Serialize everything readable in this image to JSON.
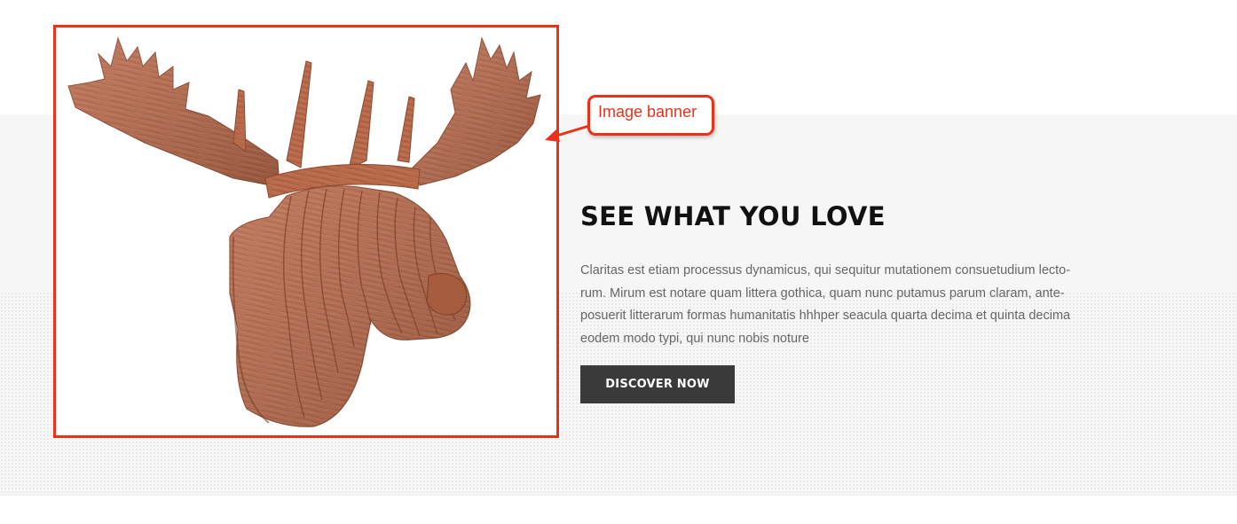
{
  "banner": {
    "image_alt": "Wooden moose head wall mount",
    "heading": "SEE WHAT YOU LOVE",
    "description": "Claritas est etiam processus dynamicus, qui sequitur mutationem consuetudium lecto-rum. Mirum est notare quam littera gothica, quam nunc putamus parum claram, ante-posuerit litterarum formas humanitatis hhhper seacula quarta decima et quinta decima eodem modo typi, qui nunc nobis noture",
    "button_label": "DISCOVER NOW"
  },
  "annotation": {
    "label": "Image banner",
    "color": "#e8321a"
  },
  "colors": {
    "button_bg": "#3a3a3a",
    "heading": "#111111",
    "body_text": "#666666",
    "band_bg": "#f6f6f6",
    "wood": "#b86a4a"
  }
}
